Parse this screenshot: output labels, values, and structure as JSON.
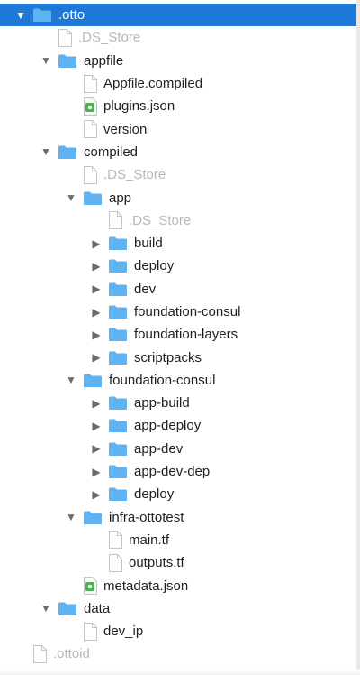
{
  "tree": [
    {
      "name": ".otto",
      "kind": "folder",
      "depth": 0,
      "expanded": true,
      "selected": true
    },
    {
      "name": ".DS_Store",
      "kind": "file",
      "depth": 1,
      "dim": true
    },
    {
      "name": "appfile",
      "kind": "folder",
      "depth": 1,
      "expanded": true
    },
    {
      "name": "Appfile.compiled",
      "kind": "file",
      "depth": 2
    },
    {
      "name": "plugins.json",
      "kind": "json",
      "depth": 2
    },
    {
      "name": "version",
      "kind": "file",
      "depth": 2
    },
    {
      "name": "compiled",
      "kind": "folder",
      "depth": 1,
      "expanded": true
    },
    {
      "name": ".DS_Store",
      "kind": "file",
      "depth": 2,
      "dim": true
    },
    {
      "name": "app",
      "kind": "folder",
      "depth": 2,
      "expanded": true
    },
    {
      "name": ".DS_Store",
      "kind": "file",
      "depth": 3,
      "dim": true
    },
    {
      "name": "build",
      "kind": "folder",
      "depth": 3,
      "expanded": false
    },
    {
      "name": "deploy",
      "kind": "folder",
      "depth": 3,
      "expanded": false
    },
    {
      "name": "dev",
      "kind": "folder",
      "depth": 3,
      "expanded": false
    },
    {
      "name": "foundation-consul",
      "kind": "folder",
      "depth": 3,
      "expanded": false
    },
    {
      "name": "foundation-layers",
      "kind": "folder",
      "depth": 3,
      "expanded": false
    },
    {
      "name": "scriptpacks",
      "kind": "folder",
      "depth": 3,
      "expanded": false
    },
    {
      "name": "foundation-consul",
      "kind": "folder",
      "depth": 2,
      "expanded": true
    },
    {
      "name": "app-build",
      "kind": "folder",
      "depth": 3,
      "expanded": false
    },
    {
      "name": "app-deploy",
      "kind": "folder",
      "depth": 3,
      "expanded": false
    },
    {
      "name": "app-dev",
      "kind": "folder",
      "depth": 3,
      "expanded": false
    },
    {
      "name": "app-dev-dep",
      "kind": "folder",
      "depth": 3,
      "expanded": false
    },
    {
      "name": "deploy",
      "kind": "folder",
      "depth": 3,
      "expanded": false
    },
    {
      "name": "infra-ottotest",
      "kind": "folder",
      "depth": 2,
      "expanded": true
    },
    {
      "name": "main.tf",
      "kind": "file",
      "depth": 3
    },
    {
      "name": "outputs.tf",
      "kind": "file",
      "depth": 3
    },
    {
      "name": "metadata.json",
      "kind": "json",
      "depth": 2
    },
    {
      "name": "data",
      "kind": "folder",
      "depth": 1,
      "expanded": true
    },
    {
      "name": "dev_ip",
      "kind": "file",
      "depth": 2
    },
    {
      "name": ".ottoid",
      "kind": "file",
      "depth": 0,
      "dim": true
    }
  ],
  "colors": {
    "selection": "#1e78d8",
    "folder": "#5fb2f0",
    "dim_text": "#b7b7b7"
  }
}
